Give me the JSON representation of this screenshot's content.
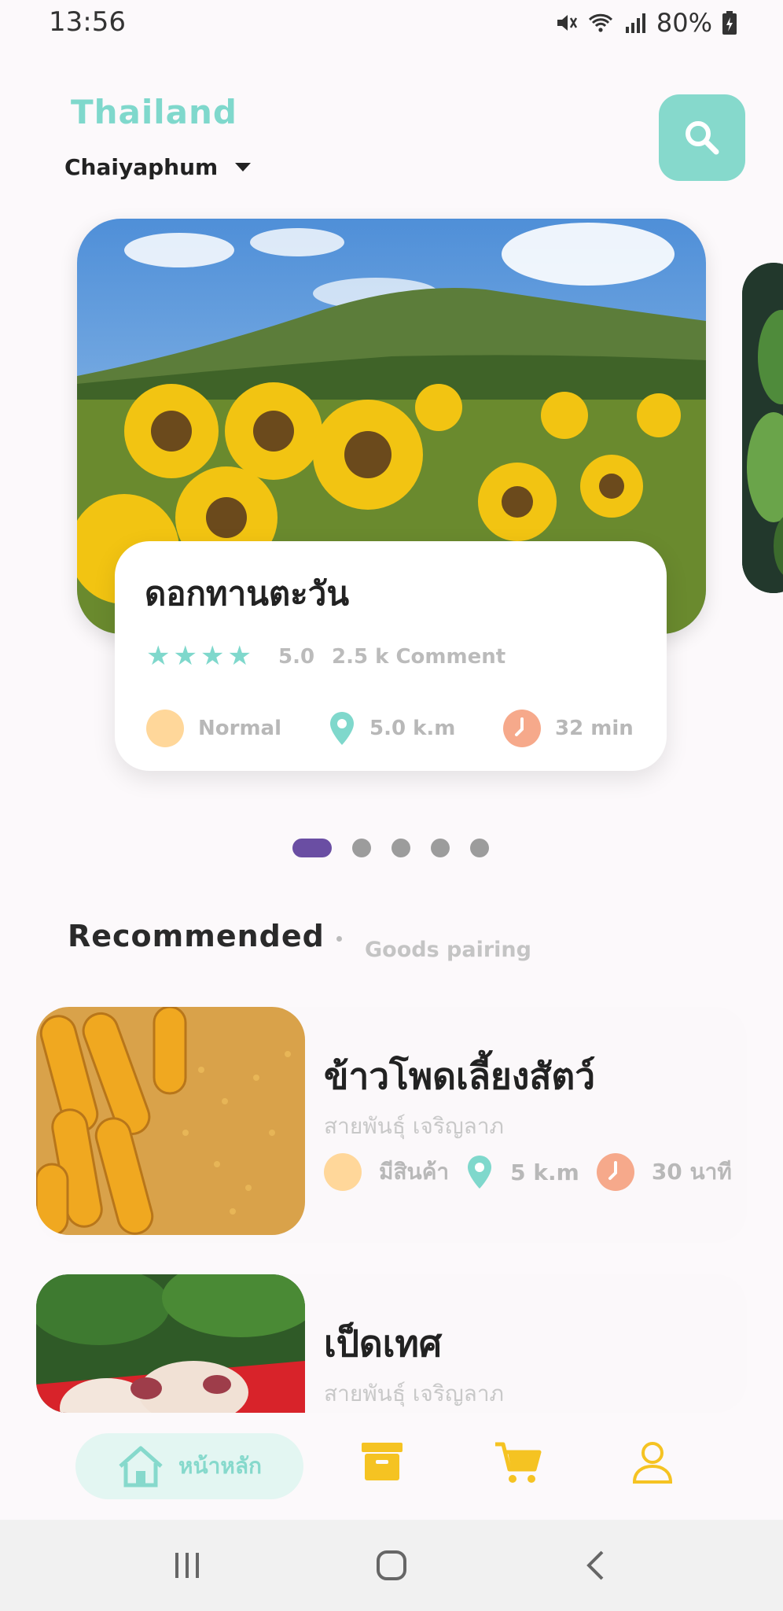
{
  "status_bar": {
    "time": "13:56",
    "battery": "80%"
  },
  "header": {
    "country": "Thailand",
    "region": "Chaiyaphum"
  },
  "featured": {
    "title": "ดอกทานตะวัน",
    "rating": "5.0",
    "comments": "2.5 k Comment",
    "level": "Normal",
    "distance": "5.0 k.m",
    "duration": "32 min",
    "stars": 4
  },
  "pager": {
    "count": 5,
    "active_index": 0
  },
  "recommended": {
    "title": "Recommended",
    "subtitle": "Goods pairing",
    "items": [
      {
        "name": "ข้าวโพดเลี้ยงสัตว์",
        "seller": "สายพันธุ์ เจริญลาภ",
        "stock": "มีสินค้า",
        "distance": "5 k.m",
        "duration": "30 นาที"
      },
      {
        "name": "เป็ดเทศ",
        "seller": "สายพันธุ์ เจริญลาภ"
      }
    ]
  },
  "bottom_nav": {
    "home_label": "หน้าหลัก"
  },
  "colors": {
    "accent": "#86d9cc",
    "orange": "#f6a98b",
    "peach": "#ffd79a",
    "pager_active": "#6a4ea3",
    "nav_yellow": "#f5c322"
  }
}
